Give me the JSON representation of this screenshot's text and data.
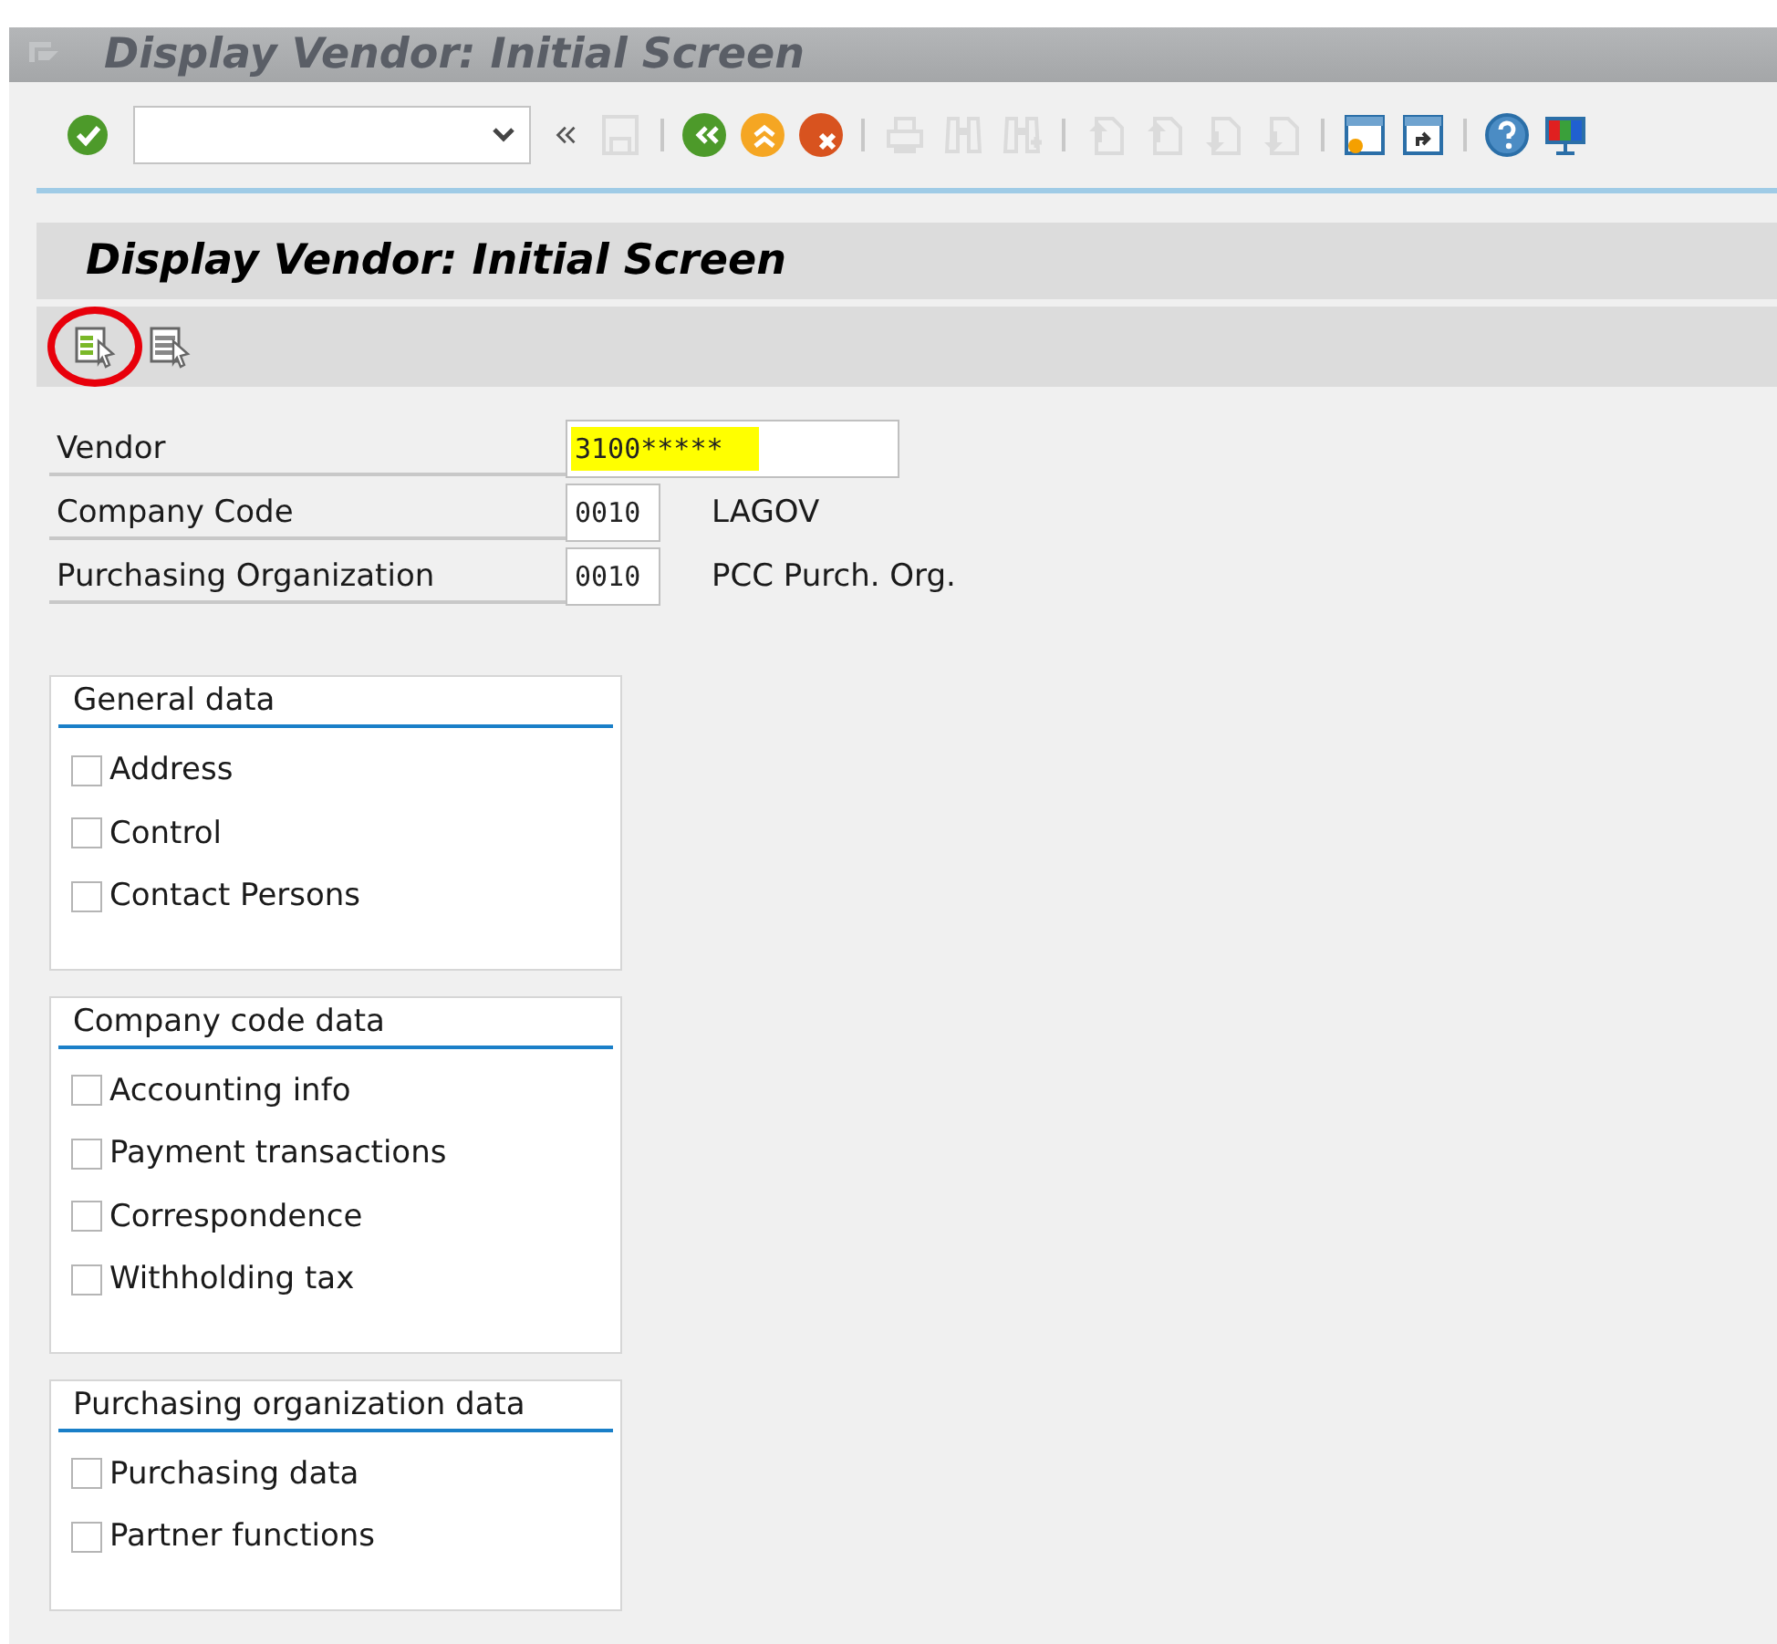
{
  "window": {
    "title": "Display Vendor:  Initial Screen"
  },
  "system_toolbar": [
    {
      "kind": "enter",
      "disabled": false
    },
    {
      "kind": "command"
    },
    {
      "kind": "collapse",
      "disabled": false
    },
    {
      "kind": "save",
      "disabled": true
    },
    {
      "kind": "sep"
    },
    {
      "kind": "back",
      "disabled": false
    },
    {
      "kind": "exit",
      "disabled": false
    },
    {
      "kind": "cancel",
      "disabled": false
    },
    {
      "kind": "sep"
    },
    {
      "kind": "print",
      "disabled": true
    },
    {
      "kind": "find",
      "disabled": true
    },
    {
      "kind": "findnext",
      "disabled": true
    },
    {
      "kind": "sep"
    },
    {
      "kind": "first",
      "disabled": true
    },
    {
      "kind": "prev",
      "disabled": true
    },
    {
      "kind": "next",
      "disabled": true
    },
    {
      "kind": "last",
      "disabled": true
    },
    {
      "kind": "sep"
    },
    {
      "kind": "newsession",
      "disabled": false
    },
    {
      "kind": "shortcut",
      "disabled": false
    },
    {
      "kind": "sep"
    },
    {
      "kind": "help",
      "disabled": false
    },
    {
      "kind": "layout",
      "disabled": false
    }
  ],
  "screen_title": "Display Vendor:  Initial Screen",
  "app_toolbar": [
    {
      "kind": "green",
      "circled": true
    },
    {
      "kind": "plain",
      "circled": false
    }
  ],
  "fields": [
    {
      "label": "Vendor",
      "value": "3100*****",
      "highlighted": true,
      "wide": true
    },
    {
      "label": "Company Code",
      "value": "0010",
      "highlighted": false,
      "wide": false,
      "description": "LAGOV"
    },
    {
      "label": "Purchasing Organization",
      "value": "0010",
      "highlighted": false,
      "wide": false,
      "description": "PCC Purch. Org."
    }
  ],
  "groups": [
    {
      "title": "General data",
      "items": [
        {
          "label": "Address",
          "checked": false
        },
        {
          "label": "Control",
          "checked": false
        },
        {
          "label": "Contact Persons",
          "checked": false
        }
      ]
    },
    {
      "title": "Company code data",
      "items": [
        {
          "label": "Accounting info",
          "checked": false
        },
        {
          "label": "Payment transactions",
          "checked": false
        },
        {
          "label": "Correspondence",
          "checked": false
        },
        {
          "label": "Withholding tax",
          "checked": false
        }
      ]
    },
    {
      "title": "Purchasing organization data",
      "items": [
        {
          "label": "Purchasing data",
          "checked": false
        },
        {
          "label": "Partner functions",
          "checked": false
        }
      ]
    }
  ]
}
